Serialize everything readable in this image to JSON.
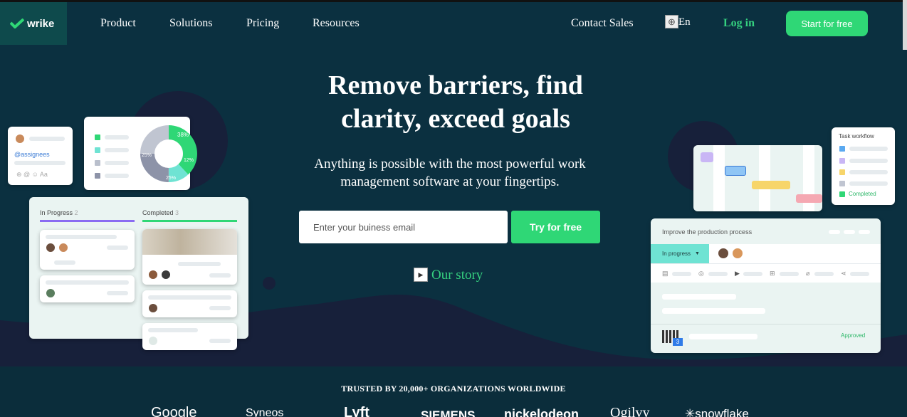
{
  "nav": {
    "logo": "wrike",
    "items": [
      "Product",
      "Solutions",
      "Pricing",
      "Resources"
    ],
    "contact_sales": "Contact Sales",
    "language": "En",
    "login": "Log in",
    "start": "Start for free"
  },
  "hero": {
    "headline_line1": "Remove barriers, find",
    "headline_line2": "clarity, exceed goals",
    "sub_line1": "Anything is possible with the most powerful work",
    "sub_line2": "management software at your fingertips.",
    "email_placeholder": "Enter your buiness email",
    "try_button": "Try for free",
    "story_link": "Our story"
  },
  "cards": {
    "assignees_tag": "@assignees",
    "assignees_icons": "⊕ @ ☺ Aa",
    "donut_labels": [
      "38%",
      "12%",
      "25%",
      "25%"
    ],
    "kanban": {
      "col1": "In Progress",
      "col1_count": "2",
      "col2": "Completed",
      "col2_count": "3"
    },
    "task_workflow": {
      "title": "Task workflow",
      "completed": "Completed"
    },
    "production": {
      "title": "Improve the production process",
      "status": "In progress",
      "approved": "Approved",
      "badge": "3"
    }
  },
  "trusted": {
    "label": "TRUSTED BY 20,000+ ORGANIZATIONS WORLDWIDE",
    "brands": [
      "Google",
      "Syneos",
      "Lyft",
      "SIEMENS",
      "nickelodeon",
      "Ogilvy",
      "snowflake"
    ]
  },
  "colors": {
    "accent": "#2fd776",
    "bg": "#0b3040",
    "purple": "#8a6cf2",
    "teal": "#6fe3d3"
  }
}
